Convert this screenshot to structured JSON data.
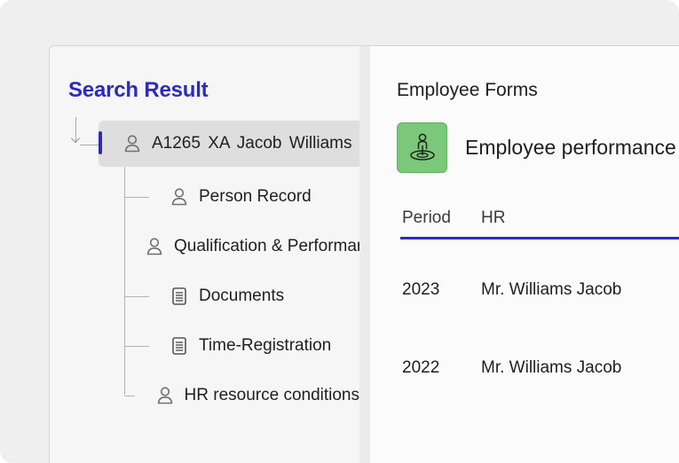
{
  "left_panel": {
    "title": "Search Result",
    "root": {
      "label": "A1265 XA  Jacob  Williams",
      "icon": "person-icon"
    },
    "children": [
      {
        "label": "Person Record",
        "icon": "person-icon"
      },
      {
        "label": "Qualification & Performance",
        "icon": "person-icon"
      },
      {
        "label": "Documents",
        "icon": "document-icon"
      },
      {
        "label": "Time-Registration",
        "icon": "document-icon"
      },
      {
        "label": "HR resource conditions",
        "icon": "person-icon"
      }
    ]
  },
  "right_panel": {
    "title": "Employee Forms",
    "form": {
      "label": "Employee performance",
      "icon": "person-on-target-icon",
      "icon_color": "#7bc87a"
    },
    "table": {
      "headers": [
        "Period",
        "HR"
      ],
      "rows": [
        [
          "2023",
          "Mr. Williams Jacob"
        ],
        [
          "2022",
          "Mr. Williams Jacob"
        ]
      ]
    }
  },
  "colors": {
    "accent": "#2b2bbf",
    "selected_row": "#dedede"
  }
}
